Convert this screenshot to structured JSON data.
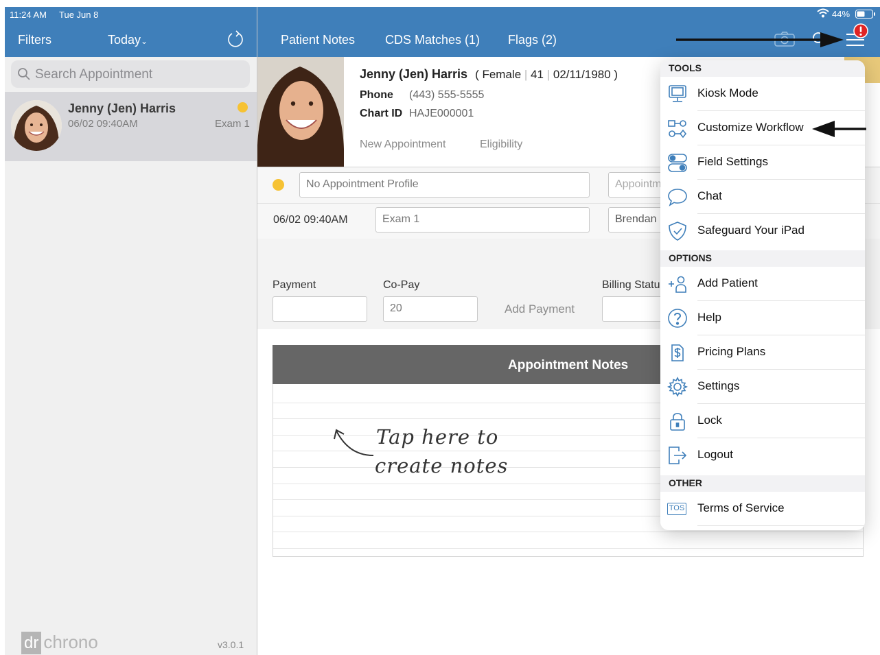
{
  "status_bar": {
    "time": "11:24 AM",
    "date": "Tue Jun 8",
    "battery": "44%"
  },
  "left_header": {
    "filters": "Filters",
    "today": "Today"
  },
  "main_nav": {
    "patient_notes": "Patient Notes",
    "cds_matches": "CDS Matches (1)",
    "flags": "Flags (2)"
  },
  "search": {
    "placeholder": "Search Appointment"
  },
  "appointment_list": [
    {
      "name": "Jenny (Jen) Harris",
      "datetime": "06/02 09:40AM",
      "room": "Exam 1",
      "status_color": "#F6C233"
    }
  ],
  "patient": {
    "name": "Jenny (Jen) Harris",
    "gender": "Female",
    "age": "41",
    "dob": "02/11/1980",
    "phone_label": "Phone",
    "phone": "(443) 555-5555",
    "chart_label": "Chart ID",
    "chart_id": "HAJE000001",
    "new_appointment": "New Appointment",
    "eligibility": "Eligibility"
  },
  "appointment": {
    "profile_placeholder": "No Appointment Profile",
    "appointment_partial": "Appointm",
    "datetime": "06/02 09:40AM",
    "room": "Exam 1",
    "provider_partial": "Brendan"
  },
  "billing": {
    "payment_label": "Payment",
    "copay_label": "Co-Pay",
    "copay_value": "20",
    "add_payment": "Add Payment",
    "billing_status_label": "Billing Statu"
  },
  "notes": {
    "header": "Appointment Notes",
    "hint_line1": "Tap here to",
    "hint_line2": "create notes"
  },
  "menu": {
    "tools_header": "TOOLS",
    "tools": [
      {
        "label": "Kiosk Mode",
        "icon": "kiosk-icon"
      },
      {
        "label": "Customize Workflow",
        "icon": "workflow-icon"
      },
      {
        "label": "Field Settings",
        "icon": "toggles-icon"
      },
      {
        "label": "Chat",
        "icon": "chat-icon"
      },
      {
        "label": "Safeguard Your iPad",
        "icon": "shield-icon"
      }
    ],
    "options_header": "OPTIONS",
    "options": [
      {
        "label": "Add Patient",
        "icon": "add-person-icon"
      },
      {
        "label": "Help",
        "icon": "help-icon"
      },
      {
        "label": "Pricing Plans",
        "icon": "dollar-icon"
      },
      {
        "label": "Settings",
        "icon": "gear-icon"
      },
      {
        "label": "Lock",
        "icon": "lock-icon"
      },
      {
        "label": "Logout",
        "icon": "logout-icon"
      }
    ],
    "other_header": "OTHER",
    "other": [
      {
        "label": "Terms of Service",
        "icon": "tos-icon",
        "badge": "TOS"
      }
    ]
  },
  "footer": {
    "logo_dr": "dr",
    "logo_chrono": "chrono",
    "version": "v3.0.1"
  },
  "colors": {
    "brand_blue": "#3F7FBA",
    "status_yellow": "#F6C233",
    "alert_red": "#E02424"
  }
}
